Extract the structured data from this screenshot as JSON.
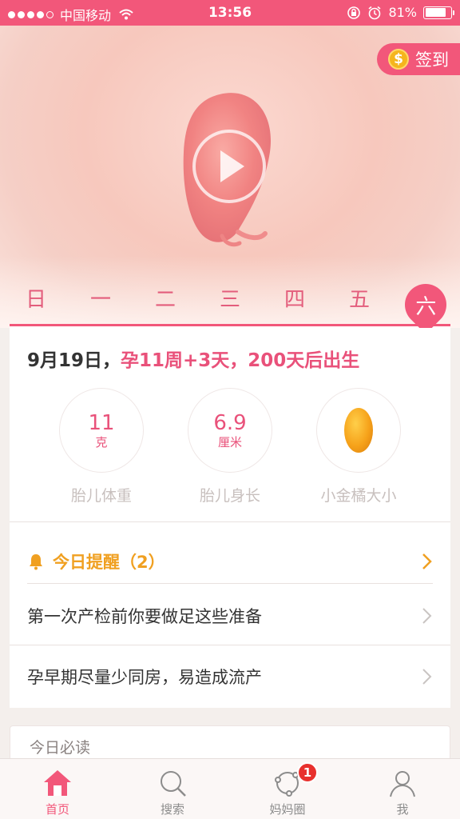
{
  "status_bar": {
    "carrier": "中国移动",
    "time": "13:56",
    "battery": "81%",
    "battery_level": 0.81
  },
  "hero": {
    "checkin_label": "签到",
    "weekdays": [
      "日",
      "一",
      "二",
      "三",
      "四",
      "五"
    ],
    "selected_day": "六"
  },
  "info": {
    "date": "9月19日，",
    "pregnancy": "孕11周+3天，200天后出生",
    "stats": [
      {
        "value": "11",
        "unit": "克",
        "label": "胎儿体重"
      },
      {
        "value": "6.9",
        "unit": "厘米",
        "label": "胎儿身长"
      },
      {
        "value": "",
        "unit": "",
        "label": "小金橘大小"
      }
    ]
  },
  "reminders": {
    "title": "今日提醒（2）",
    "items": [
      "第一次产检前你要做足这些准备",
      "孕早期尽量少同房，易造成流产"
    ]
  },
  "must_read": {
    "title": "今日必读"
  },
  "tabbar": {
    "tabs": [
      {
        "label": "首页",
        "icon": "home-icon",
        "active": true
      },
      {
        "label": "搜索",
        "icon": "search-icon"
      },
      {
        "label": "妈妈圈",
        "icon": "community-icon",
        "badge": "1"
      },
      {
        "label": "我",
        "icon": "profile-icon"
      }
    ]
  },
  "colors": {
    "brand": "#f2577a",
    "reminder": "#f0a021"
  }
}
